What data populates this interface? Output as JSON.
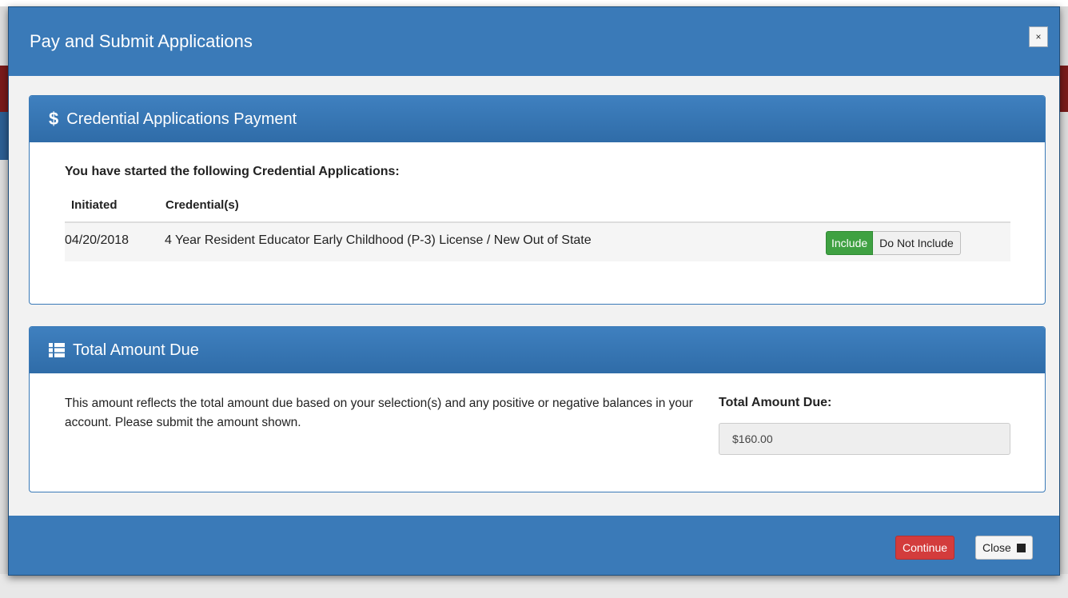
{
  "modal": {
    "title": "Pay and Submit Applications",
    "close_x_label": "×"
  },
  "payment_panel": {
    "icon": "dollar-icon",
    "icon_glyph": "$",
    "title": "Credential Applications Payment",
    "intro": "You have started the following Credential Applications:",
    "columns": [
      "Initiated",
      "Credential(s)"
    ],
    "rows": [
      {
        "initiated": "04/20/2018",
        "credential": "4 Year Resident Educator Early Childhood (P-3) License / New Out of State",
        "include_label": "Include",
        "exclude_label": "Do Not Include",
        "selected": "Include"
      }
    ]
  },
  "total_panel": {
    "icon": "list-icon",
    "title": "Total Amount Due",
    "description": "This amount reflects the total amount due based on your selection(s) and any positive or negative balances in your account. Please submit the amount shown.",
    "total_label": "Total Amount Due:",
    "total_value": "$160.00"
  },
  "footer": {
    "continue_label": "Continue",
    "close_label": "Close",
    "close_icon": "stop-icon"
  },
  "colors": {
    "header_blue": "#3a7ab8",
    "include_green": "#3fa142",
    "continue_red": "#d33c3c"
  }
}
